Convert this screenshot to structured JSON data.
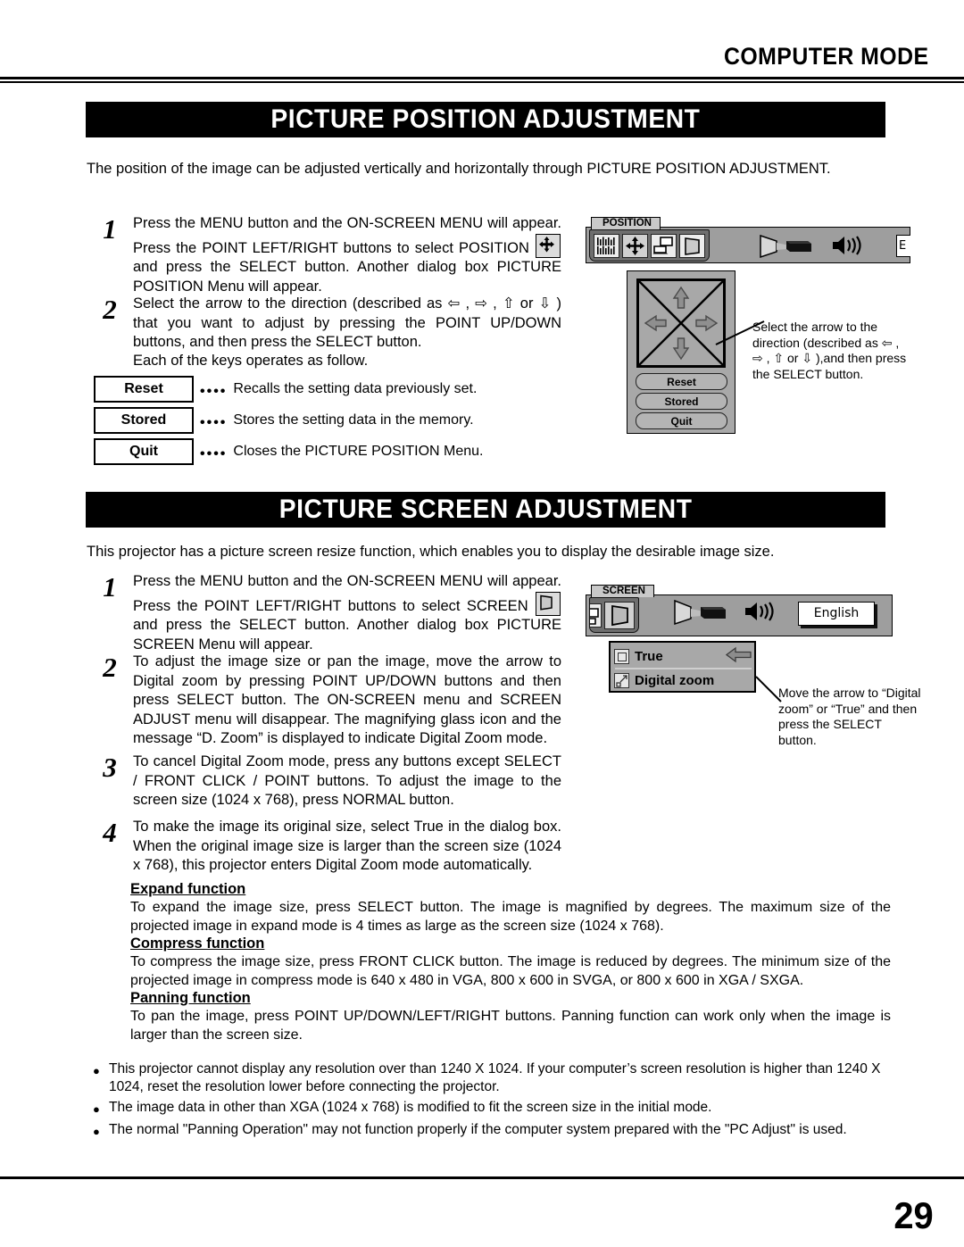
{
  "header": {
    "mode_title": "COMPUTER MODE"
  },
  "footer": {
    "page_number": "29"
  },
  "sections": [
    {
      "banner": "PICTURE POSITION ADJUSTMENT",
      "intro": "The position of the image can be adjusted vertically and horizontally through PICTURE POSITION ADJUSTMENT.",
      "steps": [
        {
          "number": "1",
          "text_a": "Press the MENU button and the ON-SCREEN MENU will appear. Press the POINT LEFT/RIGHT buttons to select POSITION ",
          "text_b": " and press the SELECT button.  Another dialog box PICTURE POSITION Menu will appear."
        },
        {
          "number": "2",
          "text": "Select the arrow to the direction (described as ⇦ , ⇨ , ⇧ or ⇩ ) that you want to adjust by pressing the POINT UP/DOWN buttons, and then press the SELECT button."
        }
      ],
      "keys_intro": "Each of the keys operates as follow.",
      "keys": [
        {
          "label": "Reset",
          "dots": "••••",
          "desc": "Recalls the setting data previously set."
        },
        {
          "label": "Stored",
          "dots": "••••",
          "desc": "Stores the setting data in the memory."
        },
        {
          "label": "Quit",
          "dots": "••••",
          "desc": "Closes the PICTURE POSITION Menu."
        }
      ]
    },
    {
      "banner": "PICTURE SCREEN ADJUSTMENT",
      "intro": "This projector has a picture screen resize function, which enables you to display the desirable image size.",
      "steps": [
        {
          "number": "1",
          "text_a": "Press the MENU button and the ON-SCREEN MENU will appear. Press the POINT LEFT/RIGHT buttons to select SCREEN ",
          "text_b": " and press the SELECT button.  Another dialog box PICTURE SCREEN Menu will appear."
        },
        {
          "number": "2",
          "text": "To adjust the image size or pan the image, move the arrow to Digital zoom by pressing POINT UP/DOWN buttons and then press SELECT button.  The ON-SCREEN menu and SCREEN ADJUST menu will disappear.  The magnifying glass icon and the message “D. Zoom” is displayed to indicate Digital Zoom mode."
        },
        {
          "number": "3",
          "text": "To cancel Digital Zoom mode, press any buttons except SELECT / FRONT CLICK / POINT buttons.  To adjust the image to the screen size (1024 x 768), press NORMAL button."
        },
        {
          "number": "4",
          "text": "To make the image its original size, select True in the dialog box. When the original image size is larger than the screen size (1024 x 768), this projector enters Digital Zoom mode automatically."
        }
      ],
      "functions": [
        {
          "title": "Expand function",
          "body": "To expand the image size, press SELECT button.  The image is magnified by degrees. The maximum size of the projected image in expand mode is 4 times as large as the screen size (1024 x 768)."
        },
        {
          "title": "Compress function",
          "body": "To compress the image size, press FRONT CLICK button.  The image is reduced by degrees.  The minimum size of the projected image in compress mode is 640 x 480 in VGA, 800 x 600 in SVGA, or 800 x 600 in XGA / SXGA."
        },
        {
          "title": "Panning function",
          "body": "To pan the image, press POINT UP/DOWN/LEFT/RIGHT buttons.  Panning function can work only when the image is larger than the screen size."
        }
      ],
      "bullets": [
        "This projector cannot display any resolution over than 1240 X 1024.  If your computer’s screen resolution is higher than 1240 X 1024, reset the resolution lower before connecting the projector.",
        "The image data in other than XGA (1024 x 768) is modified to fit the screen size in the initial mode.",
        "The normal \"Panning Operation\" may not function properly if the computer system prepared with the \"PC Adjust\" is used."
      ]
    }
  ],
  "osd_position": {
    "tab_label": "POSITION",
    "icons": [
      "pc-adjust-icon",
      "position-crosshair-icon",
      "computer-image-icon",
      "screen-icon"
    ],
    "free_icons": [
      "projector-beam-icon",
      "volume-speaker-icon",
      "language-icon"
    ],
    "partial_label": "E",
    "dialog": {
      "arrows": [
        "up-arrow",
        "left-arrow",
        "right-arrow",
        "down-arrow"
      ],
      "buttons": [
        "Reset",
        "Stored",
        "Quit"
      ]
    },
    "callout": "Select the arrow to the direction (described as ⇦ , ⇨ , ⇧ or ⇩ ),and then press the SELECT button."
  },
  "osd_screen": {
    "tab_label": "SCREEN",
    "icons": [
      "computer-image-icon-partial",
      "screen-icon-selected"
    ],
    "free_icons": [
      "projector-beam-icon",
      "volume-speaker-icon"
    ],
    "language_button": "English",
    "dialog": {
      "options": [
        {
          "label": "True",
          "icon": "true-square-icon",
          "selected": true
        },
        {
          "label": "Digital zoom",
          "icon": "digital-zoom-icon",
          "selected": false
        }
      ]
    },
    "callout": "Move the arrow to “Digital zoom” or “True” and then press the SELECT button."
  }
}
